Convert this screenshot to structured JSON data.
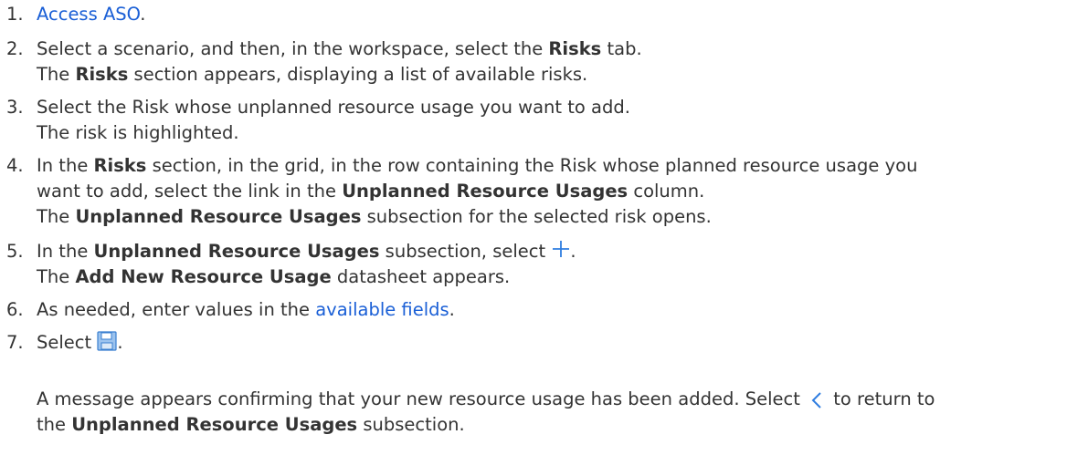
{
  "steps": [
    {
      "number": "1.",
      "link": "Access ASO",
      "after": "."
    },
    {
      "number": "2.",
      "line1": [
        "Select a scenario, and then, in the workspace, select the ",
        "Risks",
        " tab."
      ],
      "line2": [
        "The ",
        "Risks",
        " section appears, displaying a list of available risks."
      ]
    },
    {
      "number": "3.",
      "line1": "Select the Risk whose unplanned resource usage you want to add.",
      "line2": "The risk is highlighted."
    },
    {
      "number": "4.",
      "line1": [
        "In the ",
        "Risks",
        " section, in the grid, in the row containing the Risk whose planned resource usage you"
      ],
      "line2": [
        "want to add, select the link in the ",
        "Unplanned Resource Usages",
        " column."
      ],
      "line3": [
        "The ",
        "Unplanned Resource Usages",
        " subsection for the selected risk opens."
      ]
    },
    {
      "number": "5.",
      "line1": [
        "In the ",
        "Unplanned Resource Usages",
        " subsection, select ",
        "."
      ],
      "icon": "plus-icon",
      "line2": [
        "The ",
        "Add New Resource Usage",
        " datasheet appears."
      ]
    },
    {
      "number": "6.",
      "before": "As needed, enter values in the ",
      "link": "available fields",
      "after": "."
    },
    {
      "number": "7.",
      "before": "Select ",
      "icon": "save-icon",
      "after": ".",
      "para1": "A message appears confirming that your new resource usage has been added. Select ",
      "para1_icon": "chevron-left-icon",
      "para1_after": " to return to",
      "para2": [
        "the ",
        "Unplanned Resource Usages",
        " subsection."
      ]
    }
  ],
  "colors": {
    "text": "#333333",
    "link": "#1a5fd6",
    "icon": "#2f7de0",
    "save_icon_fill": "#9cc3ee"
  }
}
